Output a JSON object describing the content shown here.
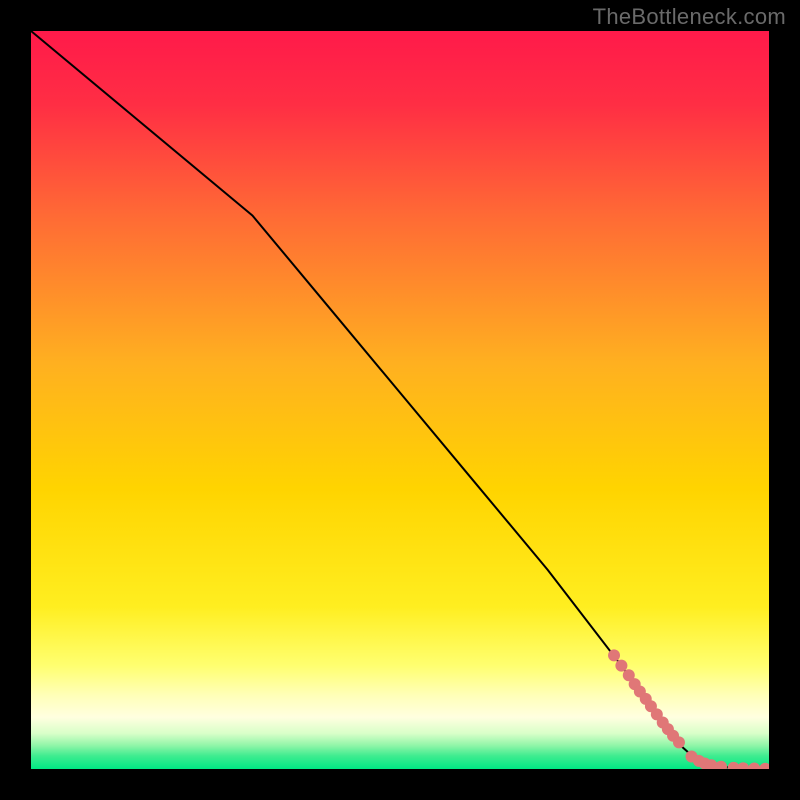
{
  "watermark": "TheBottleneck.com",
  "colors": {
    "frame": "#000000",
    "grad_top": "#ff1a4a",
    "grad_mid": "#ffd400",
    "grad_lightband_top": "#ffff8a",
    "grad_lightband_bot": "#ffffd0",
    "grad_bottom": "#00e884",
    "curve": "#000000",
    "marker": "#e07777"
  },
  "chart_data": {
    "type": "line",
    "title": "",
    "xlabel": "",
    "ylabel": "",
    "xlim": [
      0,
      100
    ],
    "ylim": [
      0,
      100
    ],
    "grid": false,
    "axes_hidden": true,
    "series": [
      {
        "name": "bottleneck-curve",
        "x": [
          0,
          30,
          40,
          50,
          60,
          70,
          80,
          84,
          88,
          90,
          92,
          94,
          96,
          98,
          100
        ],
        "y": [
          100,
          75,
          63,
          51,
          39,
          27,
          14,
          8.5,
          3.2,
          1.4,
          0.6,
          0.25,
          0.12,
          0.05,
          0.02
        ]
      }
    ],
    "markers": {
      "name": "highlighted-points",
      "color": "#e07777",
      "points": [
        {
          "x": 79.0,
          "y": 15.4
        },
        {
          "x": 80.0,
          "y": 14.0
        },
        {
          "x": 81.0,
          "y": 12.7
        },
        {
          "x": 81.8,
          "y": 11.5
        },
        {
          "x": 82.5,
          "y": 10.5
        },
        {
          "x": 83.3,
          "y": 9.5
        },
        {
          "x": 84.0,
          "y": 8.5
        },
        {
          "x": 84.8,
          "y": 7.4
        },
        {
          "x": 85.6,
          "y": 6.3
        },
        {
          "x": 86.3,
          "y": 5.4
        },
        {
          "x": 87.0,
          "y": 4.5
        },
        {
          "x": 87.8,
          "y": 3.6
        },
        {
          "x": 89.5,
          "y": 1.7
        },
        {
          "x": 90.5,
          "y": 1.1
        },
        {
          "x": 91.3,
          "y": 0.75
        },
        {
          "x": 92.2,
          "y": 0.5
        },
        {
          "x": 93.5,
          "y": 0.3
        },
        {
          "x": 95.2,
          "y": 0.16
        },
        {
          "x": 96.5,
          "y": 0.11
        },
        {
          "x": 98.0,
          "y": 0.06
        },
        {
          "x": 99.5,
          "y": 0.03
        }
      ]
    }
  }
}
